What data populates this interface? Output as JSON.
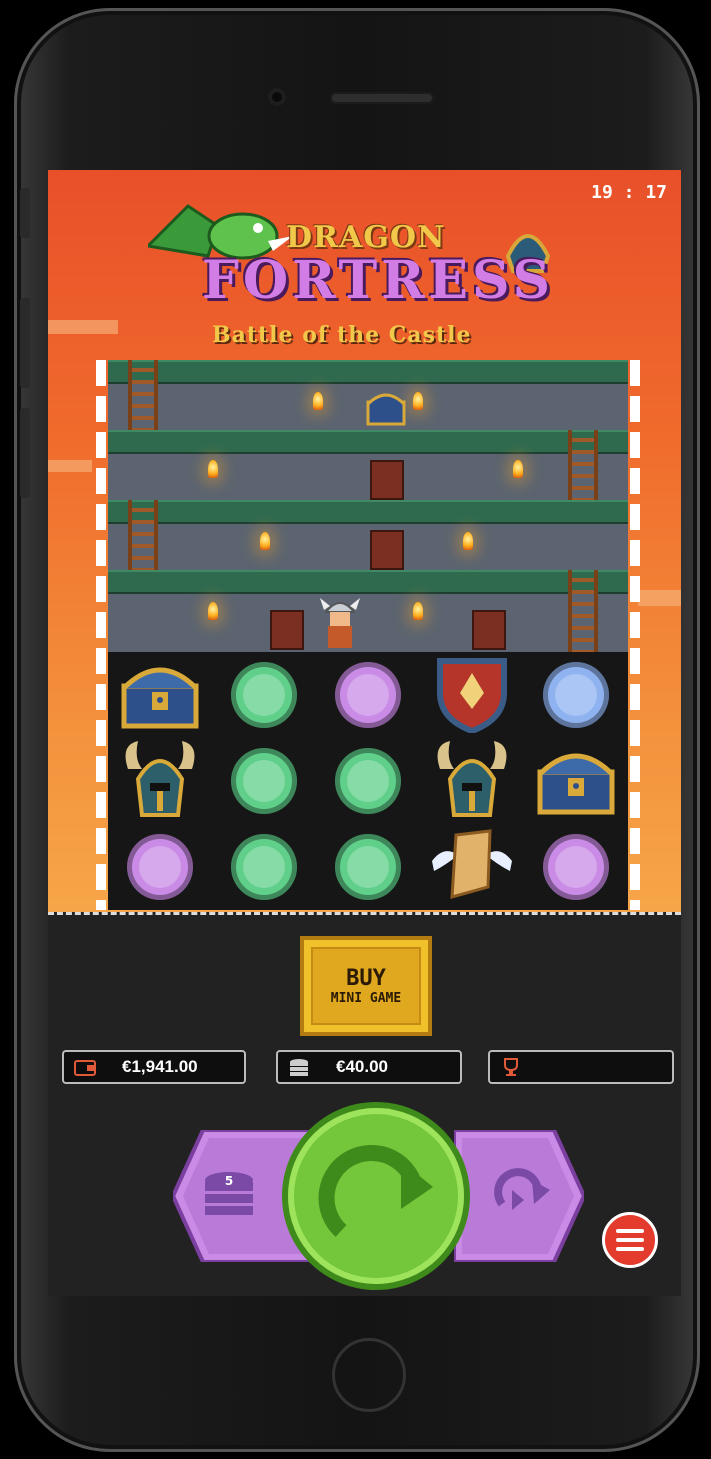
{
  "status_bar": {
    "time": "19 : 17"
  },
  "game": {
    "title_line1": "DRAGON",
    "title_line2": "FORTRESS",
    "subtitle": "Battle of the Castle"
  },
  "reels": {
    "rows": [
      [
        "treasure-chest",
        "green-coin",
        "purple-coin",
        "phoenix-shield",
        "blue-coin"
      ],
      [
        "horned-helmet",
        "green-coin",
        "green-coin",
        "horned-helmet",
        "treasure-chest"
      ],
      [
        "purple-coin",
        "green-coin",
        "green-coin",
        "winged-scroll",
        "purple-coin"
      ]
    ]
  },
  "buy_button": {
    "line1": "BUY",
    "line2": "MINI GAME"
  },
  "info": {
    "balance": "€1,941.00",
    "bet": "€40.00",
    "win": ""
  },
  "controls": {
    "bet_stack_value": "5"
  },
  "colors": {
    "green_coin": "#5fcf8a",
    "purple_coin": "#c98be6",
    "blue_coin": "#8fb3f0",
    "spin_green": "#74c63a",
    "button_purple": "#c98be6",
    "menu_red": "#e33b2c"
  }
}
